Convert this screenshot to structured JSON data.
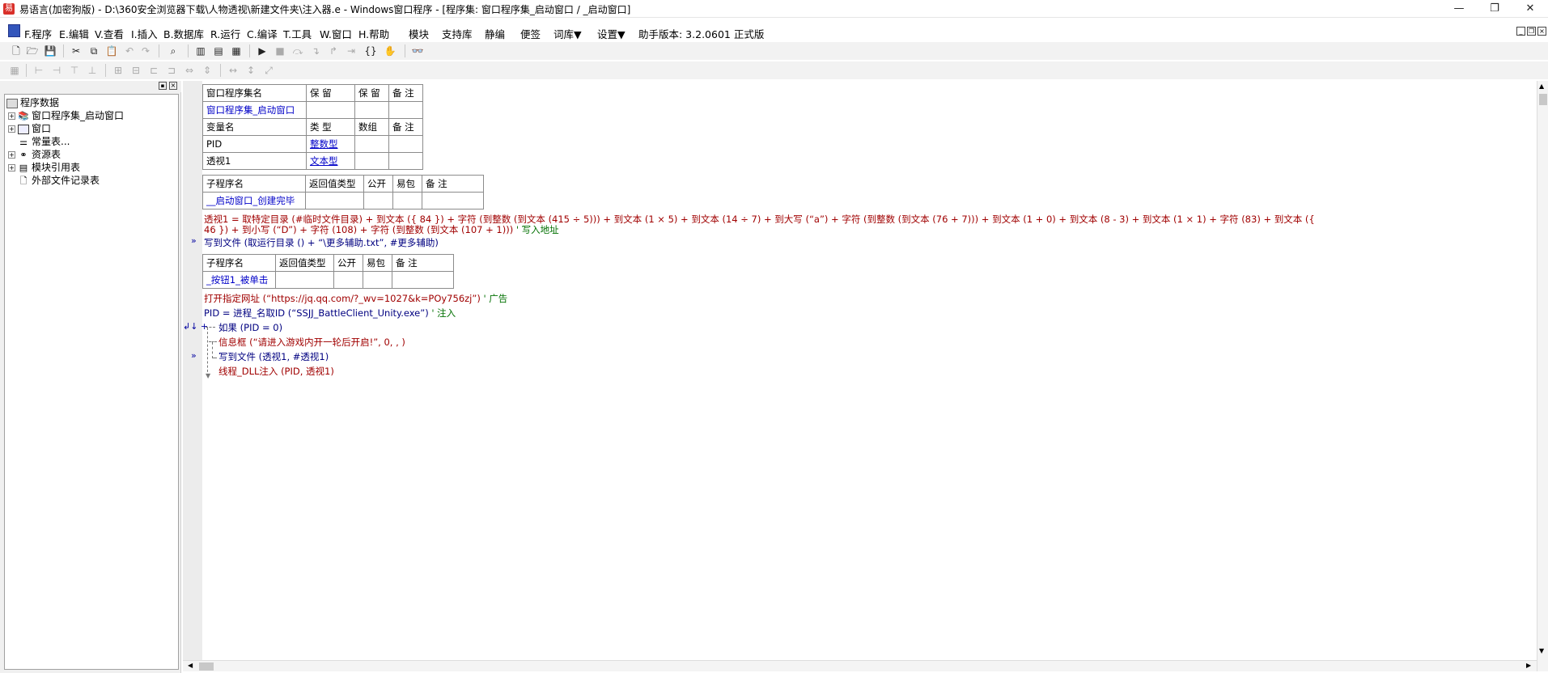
{
  "window": {
    "title": "易语言(加密狗版) - D:\\360安全浏览器下载\\人物透视\\新建文件夹\\注入器.e - Windows窗口程序 - [程序集: 窗口程序集_启动窗口 / _启动窗口]",
    "min_glyph": "—",
    "max_glyph": "❐",
    "close_glyph": "✕"
  },
  "menu": {
    "items": [
      "F.程序",
      "E.编辑",
      "V.查看",
      "I.插入",
      "B.数据库",
      "R.运行",
      "C.编译",
      "T.工具",
      "W.窗口",
      "H.帮助",
      "模块",
      "支持库",
      "静编",
      "便签",
      "词库▼",
      "设置▼",
      "助手版本: 3.2.0601 正式版"
    ]
  },
  "tree": {
    "root": "程序数据",
    "items": [
      "窗口程序集_启动窗口",
      "窗口",
      "常量表...",
      "资源表",
      "模块引用表",
      "外部文件记录表"
    ]
  },
  "assembly_table": {
    "header": [
      "窗口程序集名",
      "保 留",
      "保 留",
      "备 注"
    ],
    "row": [
      "窗口程序集_启动窗口",
      "",
      "",
      ""
    ]
  },
  "var_table": {
    "header": [
      "变量名",
      "类 型",
      "数组",
      "备 注"
    ],
    "rows": [
      [
        "PID",
        "整数型",
        "",
        ""
      ],
      [
        "透视1",
        "文本型",
        "",
        ""
      ]
    ]
  },
  "sub1_table": {
    "header": [
      "子程序名",
      "返回值类型",
      "公开",
      "易包",
      "备 注"
    ],
    "row": [
      "__启动窗口_创建完毕",
      "",
      "",
      "",
      ""
    ]
  },
  "code1": {
    "line1": "透视1 = 取特定目录 (#临时文件目录) + 到文本 ({ 84 }) + 字符 (到整数 (到文本 (415 ÷ 5))) + 到文本 (1 × 5) + 到文本 (14 ÷ 7) + 到大写 (“a”) + 字符 (到整数 (到文本 (76 + 7))) + 到文本 (1 + 0) + 到文本 (8 - 3) + 到文本 (1 × 1) + 字符 (83) + 到文本 ({",
    "line2": "46 }) + 到小写 (“D”) + 字符 (108) + 字符 (到整数 (到文本 (107 + 1)))",
    "line2_comment": "' 写入地址",
    "line3": "写到文件 (取运行目录 () + “\\更多辅助.txt”, #更多辅助)"
  },
  "sub2_table": {
    "header": [
      "子程序名",
      "返回值类型",
      "公开",
      "易包",
      "备 注"
    ],
    "row": [
      "_按钮1_被单击",
      "",
      "",
      "",
      ""
    ]
  },
  "code2": {
    "line1": "打开指定网址 (“https://jq.qq.com/?_wv=1027&k=POy756zj”)",
    "line1_comment": "' 广告",
    "line2": "PID = 进程_名取ID (“SSJJ_BattleClient_Unity.exe”)",
    "line2_comment": "' 注入",
    "line3": "如果 (PID = 0)",
    "line4": "信息框 (“请进入游戏内开一轮后开启!”, 0, , )",
    "line5": "写到文件 (透视1, #透视1)",
    "line6": "线程_DLL注入 (PID, 透视1)"
  },
  "markers": {
    "fold": "»",
    "if_mark": "↲↓ +"
  }
}
